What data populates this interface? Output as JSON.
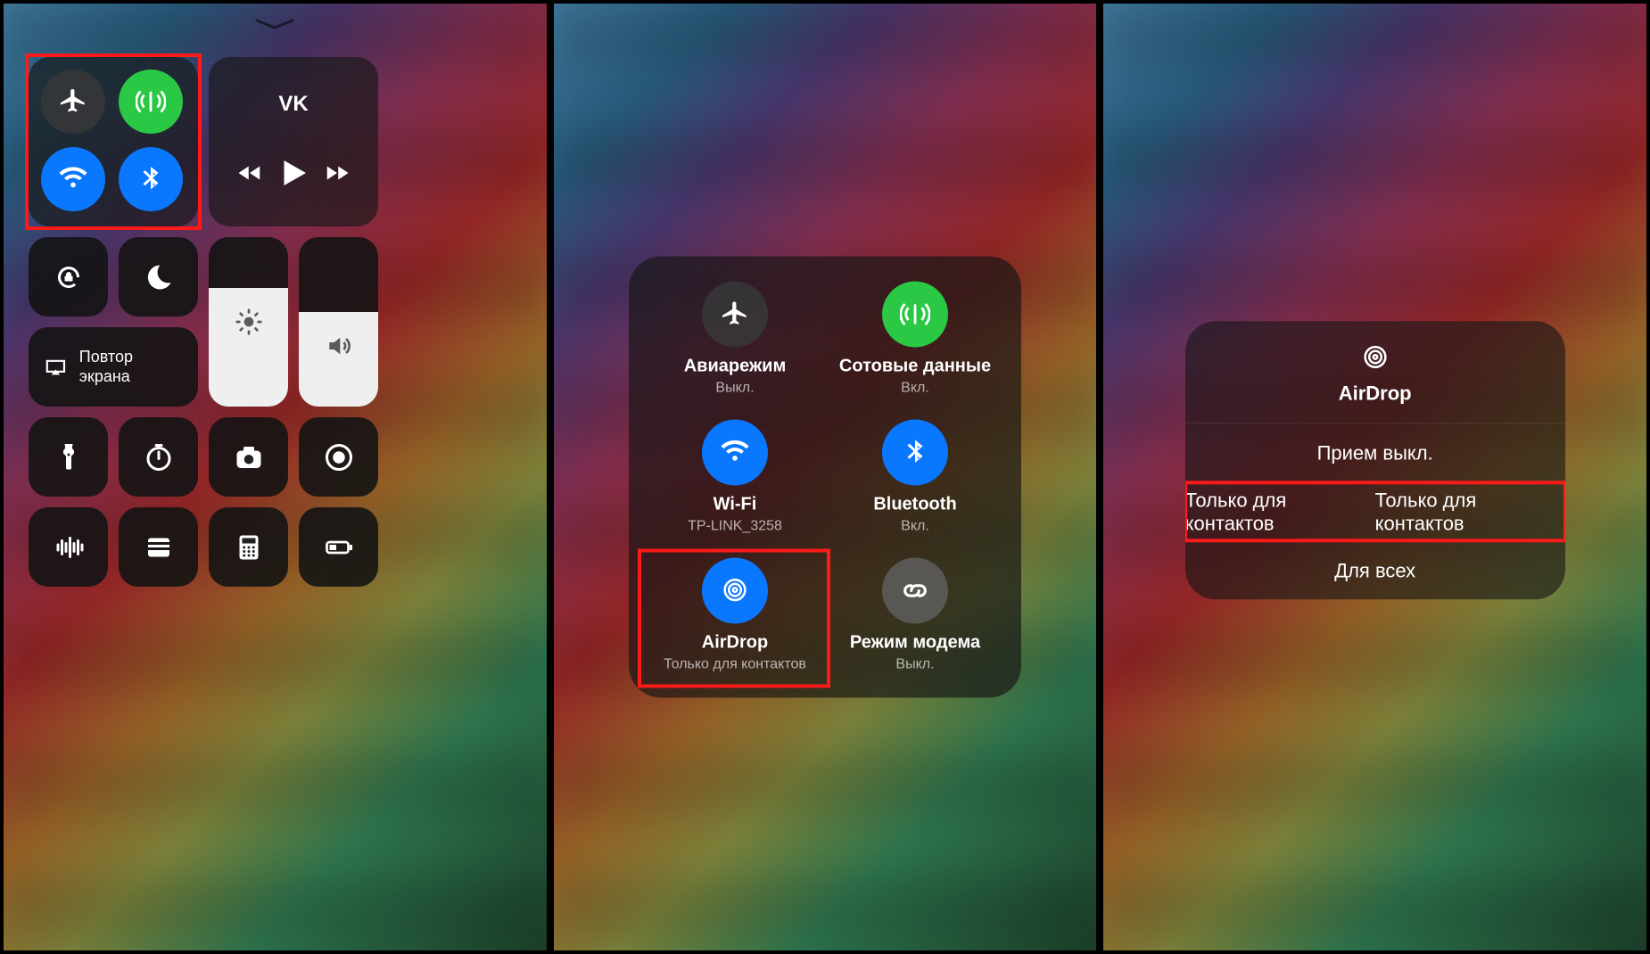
{
  "panel1": {
    "media_title": "VK",
    "screen_mirror_label": "Повтор экрана"
  },
  "panel2": {
    "airplane": {
      "label": "Авиарежим",
      "sub": "Выкл."
    },
    "cellular": {
      "label": "Сотовые данные",
      "sub": "Вкл."
    },
    "wifi": {
      "label": "Wi-Fi",
      "sub": "TP-LINK_3258"
    },
    "bluetooth": {
      "label": "Bluetooth",
      "sub": "Вкл."
    },
    "airdrop": {
      "label": "AirDrop",
      "sub": "Только для контактов"
    },
    "hotspot": {
      "label": "Режим модема",
      "sub": "Выкл."
    }
  },
  "panel3": {
    "title": "AirDrop",
    "options": [
      "Прием выкл.",
      "Только для контактов",
      "Для всех"
    ]
  },
  "colors": {
    "blue": "#0a77ff",
    "green": "#2ac845",
    "highlight": "#ff1a1a"
  }
}
